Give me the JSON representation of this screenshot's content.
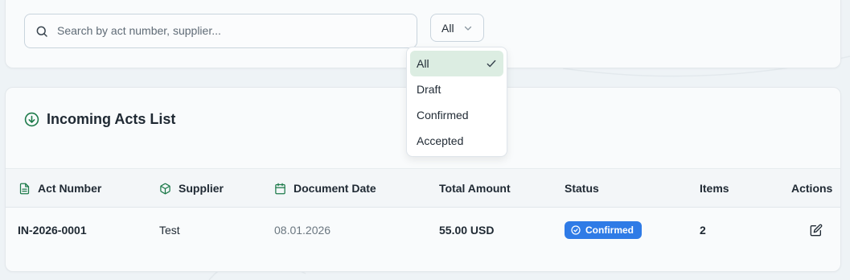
{
  "search": {
    "placeholder": "Search by act number, supplier..."
  },
  "status_filter": {
    "value": "All",
    "options": [
      {
        "label": "All",
        "selected": true
      },
      {
        "label": "Draft",
        "selected": false
      },
      {
        "label": "Confirmed",
        "selected": false
      },
      {
        "label": "Accepted",
        "selected": false
      }
    ]
  },
  "list": {
    "title": "Incoming Acts List",
    "columns": {
      "act_number": "Act Number",
      "supplier": "Supplier",
      "document_date": "Document Date",
      "total_amount": "Total Amount",
      "status": "Status",
      "items": "Items",
      "actions": "Actions"
    },
    "rows": [
      {
        "act_number": "IN-2026-0001",
        "supplier": "Test",
        "document_date": "08.01.2026",
        "total_amount": "55.00 USD",
        "status": "Confirmed",
        "items": "2"
      }
    ]
  },
  "icons": {
    "search": "search-icon",
    "chevron": "chevron-down-icon",
    "check": "check-icon",
    "title": "arrow-down-circle-icon",
    "act_number": "file-text-icon",
    "supplier": "package-icon",
    "document_date": "calendar-icon",
    "status_badge": "check-circle-icon",
    "edit": "edit-icon"
  },
  "colors": {
    "accent_green": "#1d7a4a",
    "selected_bg": "#dcede2",
    "badge_blue": "#2f7be6"
  }
}
